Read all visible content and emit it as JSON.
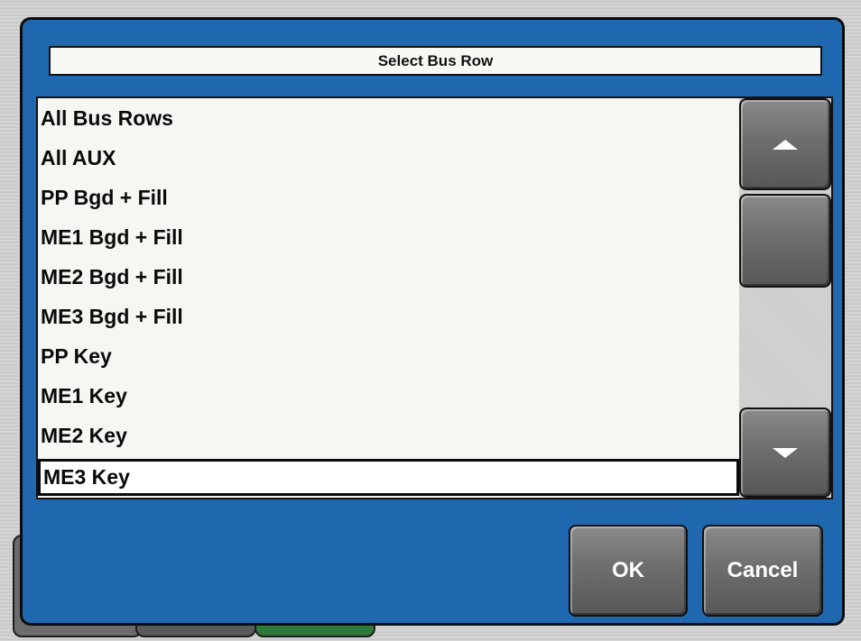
{
  "dialog": {
    "title": "Select Bus Row"
  },
  "list": {
    "items": [
      {
        "label": "All Bus Rows"
      },
      {
        "label": "All AUX"
      },
      {
        "label": "PP Bgd + Fill"
      },
      {
        "label": "ME1 Bgd + Fill"
      },
      {
        "label": "ME2 Bgd + Fill"
      },
      {
        "label": "ME3 Bgd + Fill"
      },
      {
        "label": "PP Key"
      },
      {
        "label": "ME1 Key"
      },
      {
        "label": "ME2 Key"
      },
      {
        "label": "ME3 Key"
      }
    ],
    "selected": "ME3 Key"
  },
  "scrollbar": {
    "up_icon": "triangle-up-icon",
    "down_icon": "triangle-down-icon"
  },
  "buttons": {
    "ok_label": "OK",
    "cancel_label": "Cancel"
  },
  "colors": {
    "dialog_blue": "#1f67ae",
    "button_gray": "#6e6e6e",
    "list_bg": "#f6f6f2"
  }
}
